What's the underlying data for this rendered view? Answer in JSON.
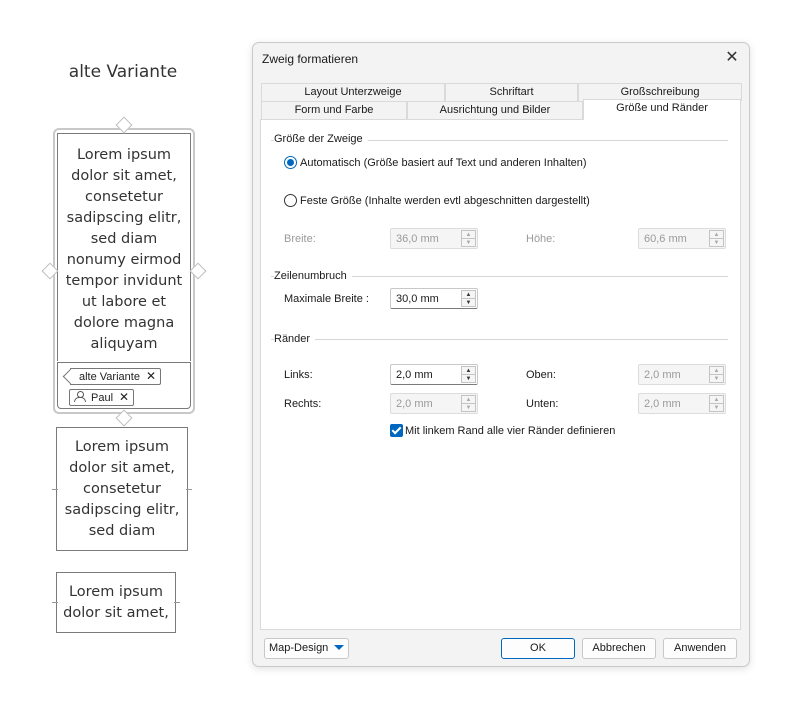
{
  "preview": {
    "old_variant_title": "alte Variante",
    "main_topic_lines": [
      "Lorem ipsum",
      "dolor sit amet,",
      "consetetur",
      "sadipscing elitr,",
      "sed diam",
      "nonumy eirmod",
      "tempor invidunt",
      "ut labore et",
      "dolore magna",
      "aliquyam"
    ],
    "tag_variant": "alte Variante",
    "tag_person": "Paul",
    "tag_close": "✕",
    "topic2_lines": [
      "Lorem ipsum",
      "dolor sit amet,",
      "consetetur",
      "sadipscing elitr,",
      "sed diam"
    ],
    "topic3_lines": [
      "Lorem ipsum",
      "dolor sit amet,"
    ]
  },
  "dialog": {
    "title": "Zweig formatieren",
    "close_glyph": "✕",
    "tabs_row1": [
      "Layout Unterzweige",
      "Schriftart",
      "Großschreibung"
    ],
    "tabs_row2": [
      "Form und Farbe",
      "Ausrichtung und Bilder",
      "Größe und Ränder"
    ],
    "active_tab": "Größe und Ränder",
    "size_group": "Größe der Zweige",
    "radio_auto": "Automatisch (Größe basiert auf Text und anderen Inhalten)",
    "radio_fixed": "Feste Größe (Inhalte werden evtl abgeschnitten dargestellt)",
    "width_label": "Breite:",
    "width_value": "36,0 mm",
    "height_label": "Höhe:",
    "height_value": "60,6 mm",
    "wrap_group": "Zeilenumbruch",
    "max_width_label": "Maximale Breite :",
    "max_width_value": "30,0 mm",
    "margins_group": "Ränder",
    "left_label": "Links:",
    "left_value": "2,0 mm",
    "top_label": "Oben:",
    "top_value": "2,0 mm",
    "right_label": "Rechts:",
    "right_value": "2,0 mm",
    "bottom_label": "Unten:",
    "bottom_value": "2,0 mm",
    "checkbox_label": "Mit linkem Rand alle vier Ränder definieren",
    "map_design_label": "Map-Design",
    "ok_label": "OK",
    "cancel_label": "Abbrechen",
    "apply_label": "Anwenden",
    "arrow_up": "▲",
    "arrow_down": "▼"
  },
  "colors": {
    "accent": "#0067c0",
    "dialog_bg": "#f3f3f3",
    "panel_bg": "#ffffff"
  }
}
